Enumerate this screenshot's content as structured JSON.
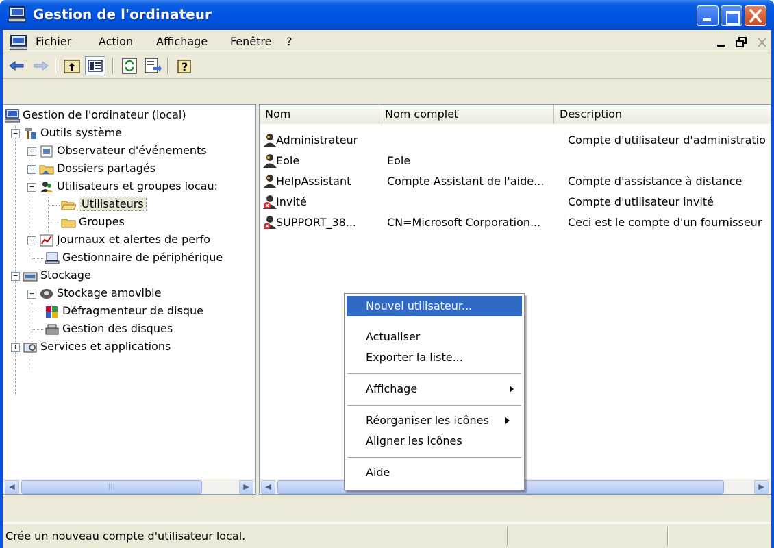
{
  "window": {
    "title": "Gestion de l'ordinateur",
    "accent": "#0054e3",
    "close_color": "#c94a1f"
  },
  "menubar": {
    "items": [
      "Fichier",
      "Action",
      "Affichage",
      "Fenêtre",
      "?"
    ]
  },
  "toolbar": {
    "buttons": [
      "back-arrow-icon",
      "forward-arrow-icon",
      "up-folder-icon",
      "show-hide-tree-icon",
      "refresh-icon",
      "export-list-icon",
      "help-icon"
    ]
  },
  "tree": {
    "root": "Gestion de l'ordinateur (local)",
    "items": [
      {
        "label": "Outils système"
      },
      {
        "label": "Observateur d'événements"
      },
      {
        "label": "Dossiers partagés"
      },
      {
        "label": "Utilisateurs et groupes locau:"
      },
      {
        "label": "Utilisateurs",
        "selected": true
      },
      {
        "label": "Groupes"
      },
      {
        "label": "Journaux et alertes de perfo"
      },
      {
        "label": "Gestionnaire de périphérique"
      },
      {
        "label": "Stockage"
      },
      {
        "label": "Stockage amovible"
      },
      {
        "label": "Défragmenteur de disque"
      },
      {
        "label": "Gestion des disques"
      },
      {
        "label": "Services et applications"
      }
    ]
  },
  "list": {
    "columns": [
      "Nom",
      "Nom complet",
      "Description"
    ],
    "rows": [
      {
        "name": "Administrateur",
        "full_name": "",
        "description": "Compte d'utilisateur d'administratio",
        "disabled": false
      },
      {
        "name": "Eole",
        "full_name": "Eole",
        "description": "",
        "disabled": false
      },
      {
        "name": "HelpAssistant",
        "full_name": "Compte Assistant de l'aide...",
        "description": "Compte d'assistance à distance",
        "disabled": false
      },
      {
        "name": "Invité",
        "full_name": "",
        "description": "Compte d'utilisateur invité",
        "disabled": true
      },
      {
        "name": "SUPPORT_38...",
        "full_name": "CN=Microsoft Corporation...",
        "description": "Ceci est le compte d'un fournisseur",
        "disabled": true
      }
    ]
  },
  "context_menu": {
    "items": [
      {
        "label": "Nouvel utilisateur...",
        "highlighted": true
      },
      {
        "label": "Actualiser"
      },
      {
        "label": "Exporter la liste..."
      },
      {
        "label": "Affichage",
        "submenu": true
      },
      {
        "label": "Réorganiser les icônes",
        "submenu": true
      },
      {
        "label": "Aligner les icônes"
      },
      {
        "label": "Aide"
      }
    ]
  },
  "status": {
    "text": "Crée un nouveau compte d'utilisateur local."
  }
}
